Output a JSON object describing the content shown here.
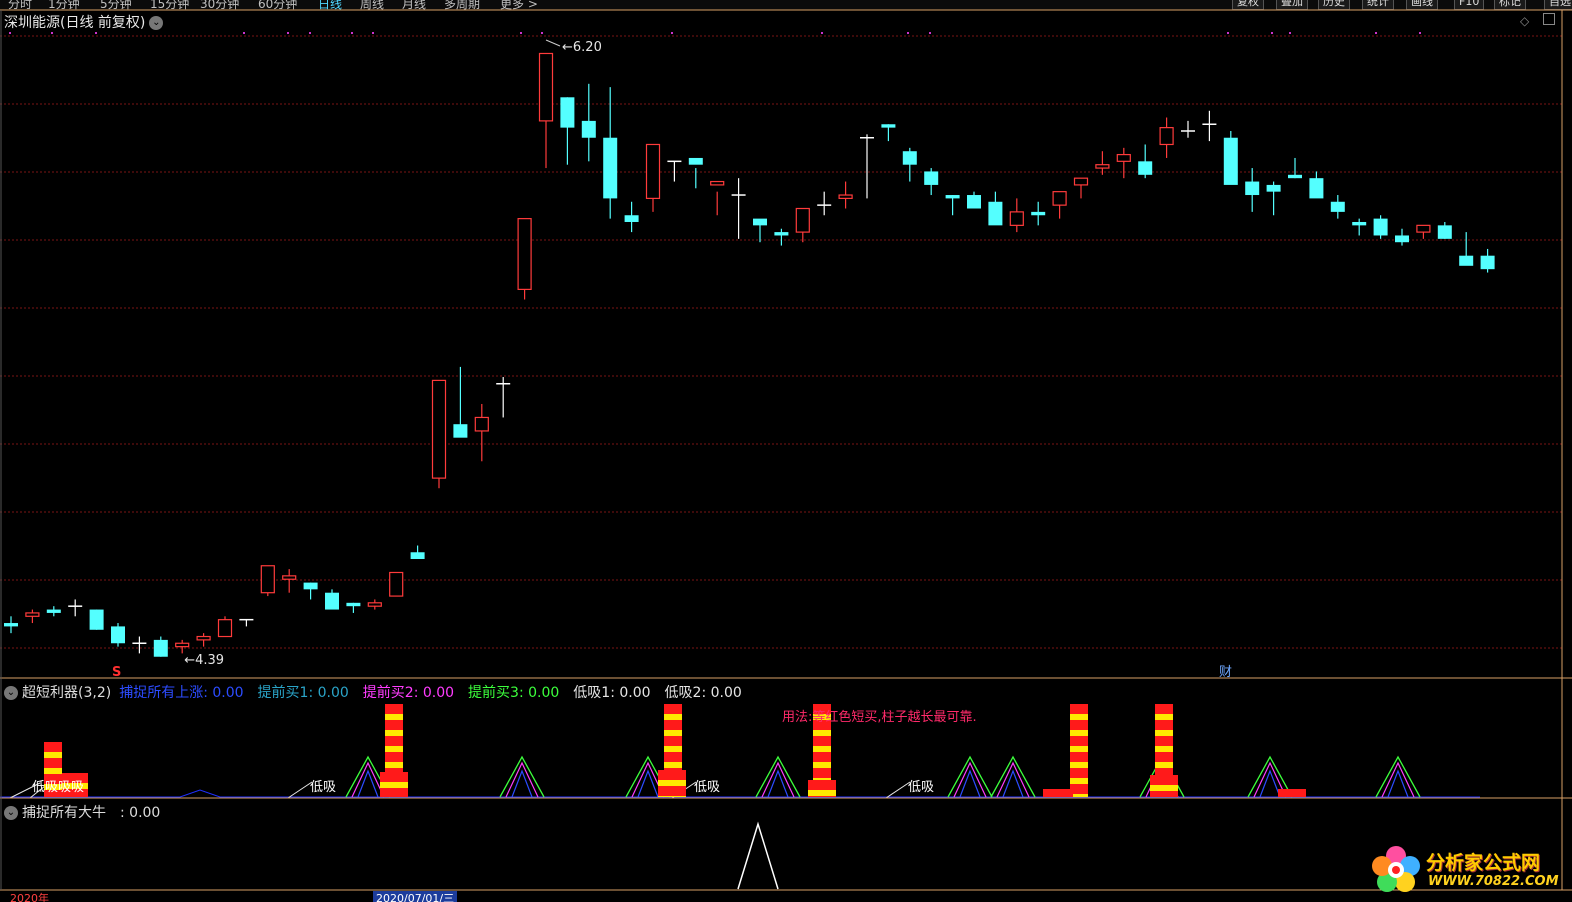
{
  "toolbar": {
    "timeframes": [
      {
        "label": "分时",
        "active": false
      },
      {
        "label": "1分钟",
        "active": false
      },
      {
        "label": "5分钟",
        "active": false
      },
      {
        "label": "15分钟",
        "active": false
      },
      {
        "label": "30分钟",
        "active": false
      },
      {
        "label": "60分钟",
        "active": false
      },
      {
        "label": "日线",
        "active": true
      },
      {
        "label": "周线",
        "active": false
      },
      {
        "label": "月线",
        "active": false
      },
      {
        "label": "多周期",
        "active": false
      },
      {
        "label": "更多 >",
        "active": false
      }
    ],
    "buttons": [
      "复权",
      "叠加",
      "历史",
      "统计",
      "画线",
      "F10",
      "标记",
      "自选"
    ]
  },
  "main_chart": {
    "title": "深圳能源(日线 前复权)",
    "high_label": "6.20",
    "low_label": "4.39",
    "marker_s": "S",
    "marker_cai": "财"
  },
  "indicator1": {
    "title": "超短利器(3,2)",
    "params": [
      {
        "text": "捕捉所有上涨: 0.00",
        "color": "#2c4cff"
      },
      {
        "text": "提前买1: 0.00",
        "color": "#2aa4c8"
      },
      {
        "text": "提前买2: 0.00",
        "color": "#ff3cff"
      },
      {
        "text": "提前买3: 0.00",
        "color": "#3cff3c"
      },
      {
        "text": "低吸1: 0.00",
        "color": "#e6e6e6"
      },
      {
        "text": "低吸2: 0.00",
        "color": "#e6e6e6"
      }
    ],
    "hint": "用法:等红色短买,柱子越长最可靠.",
    "dixi_label": "低吸",
    "dixi_double": "低吸吸吸"
  },
  "indicator2": {
    "title": "捕捉所有大牛",
    "value": ": 0.00"
  },
  "date_axis": [
    "2020年",
    "2020/07/01/三"
  ],
  "logo": {
    "name": "分析家公式网",
    "url": "WWW.70822.COM"
  },
  "colors": {
    "up": "#ff3b3b",
    "down": "#54ffff",
    "grid": "#7a1414",
    "separator": "#d9a066"
  },
  "chart_data": {
    "type": "candlestick",
    "title": "深圳能源(日线 前复权)",
    "labeled_extremes": {
      "high": 6.2,
      "low": 4.39
    },
    "ohlc": [
      [
        4.47,
        4.49,
        4.44,
        4.46
      ],
      [
        4.49,
        4.51,
        4.47,
        4.5
      ],
      [
        4.51,
        4.52,
        4.49,
        4.5
      ],
      [
        4.52,
        4.54,
        4.49,
        4.52
      ],
      [
        4.51,
        4.51,
        4.45,
        4.45
      ],
      [
        4.46,
        4.47,
        4.4,
        4.41
      ],
      [
        4.41,
        4.43,
        4.38,
        4.41
      ],
      [
        4.42,
        4.43,
        4.37,
        4.37
      ],
      [
        4.4,
        4.42,
        4.38,
        4.41
      ],
      [
        4.42,
        4.44,
        4.4,
        4.43
      ],
      [
        4.43,
        4.49,
        4.43,
        4.48
      ],
      [
        4.48,
        4.48,
        4.46,
        4.48
      ],
      [
        4.56,
        4.63,
        4.55,
        4.64
      ],
      [
        4.6,
        4.63,
        4.56,
        4.61
      ],
      [
        4.59,
        4.59,
        4.54,
        4.57
      ],
      [
        4.56,
        4.57,
        4.52,
        4.51
      ],
      [
        4.53,
        4.53,
        4.5,
        4.52
      ],
      [
        4.52,
        4.54,
        4.51,
        4.53
      ],
      [
        4.55,
        4.6,
        4.55,
        4.62
      ],
      [
        4.68,
        4.7,
        4.67,
        4.66
      ],
      [
        4.9,
        5.07,
        4.87,
        5.19
      ],
      [
        5.06,
        5.23,
        5.03,
        5.02
      ],
      [
        5.04,
        5.12,
        4.95,
        5.08
      ],
      [
        5.18,
        5.2,
        5.08,
        5.18
      ],
      [
        5.46,
        5.61,
        5.43,
        5.67
      ],
      [
        5.96,
        5.99,
        5.82,
        6.16
      ],
      [
        6.03,
        6.03,
        5.83,
        5.94
      ],
      [
        5.96,
        6.07,
        5.84,
        5.91
      ],
      [
        5.91,
        6.06,
        5.67,
        5.73
      ],
      [
        5.68,
        5.72,
        5.63,
        5.66
      ],
      [
        5.73,
        5.87,
        5.69,
        5.89
      ],
      [
        5.84,
        5.84,
        5.78,
        5.84
      ],
      [
        5.85,
        5.82,
        5.76,
        5.83
      ],
      [
        5.77,
        5.75,
        5.68,
        5.78
      ],
      [
        5.74,
        5.79,
        5.61,
        5.74
      ],
      [
        5.67,
        5.66,
        5.6,
        5.65
      ],
      [
        5.63,
        5.64,
        5.59,
        5.62
      ],
      [
        5.63,
        5.7,
        5.6,
        5.7
      ],
      [
        5.71,
        5.75,
        5.68,
        5.71
      ],
      [
        5.73,
        5.78,
        5.7,
        5.74
      ],
      [
        5.91,
        5.92,
        5.73,
        5.91
      ],
      [
        5.95,
        5.95,
        5.9,
        5.94
      ],
      [
        5.87,
        5.88,
        5.78,
        5.83
      ],
      [
        5.81,
        5.82,
        5.74,
        5.77
      ],
      [
        5.74,
        5.74,
        5.68,
        5.73
      ],
      [
        5.74,
        5.75,
        5.71,
        5.7
      ],
      [
        5.72,
        5.75,
        5.68,
        5.65
      ],
      [
        5.65,
        5.73,
        5.63,
        5.69
      ],
      [
        5.69,
        5.72,
        5.65,
        5.68
      ],
      [
        5.71,
        5.73,
        5.67,
        5.75
      ],
      [
        5.77,
        5.78,
        5.73,
        5.79
      ],
      [
        5.82,
        5.87,
        5.8,
        5.83
      ],
      [
        5.84,
        5.88,
        5.79,
        5.86
      ],
      [
        5.84,
        5.89,
        5.79,
        5.8
      ],
      [
        5.89,
        5.97,
        5.85,
        5.94
      ],
      [
        5.93,
        5.96,
        5.91,
        5.93
      ],
      [
        5.95,
        5.99,
        5.9,
        5.95
      ],
      [
        5.91,
        5.93,
        5.78,
        5.77
      ],
      [
        5.78,
        5.82,
        5.69,
        5.74
      ],
      [
        5.77,
        5.78,
        5.68,
        5.75
      ],
      [
        5.8,
        5.85,
        5.79,
        5.79
      ],
      [
        5.79,
        5.81,
        5.74,
        5.73
      ],
      [
        5.72,
        5.74,
        5.67,
        5.69
      ],
      [
        5.66,
        5.67,
        5.62,
        5.65
      ],
      [
        5.67,
        5.68,
        5.61,
        5.62
      ],
      [
        5.62,
        5.64,
        5.59,
        5.6
      ],
      [
        5.63,
        5.65,
        5.61,
        5.65
      ],
      [
        5.65,
        5.66,
        5.61,
        5.61
      ],
      [
        5.56,
        5.63,
        5.54,
        5.53
      ],
      [
        5.56,
        5.58,
        5.51,
        5.52
      ]
    ]
  }
}
